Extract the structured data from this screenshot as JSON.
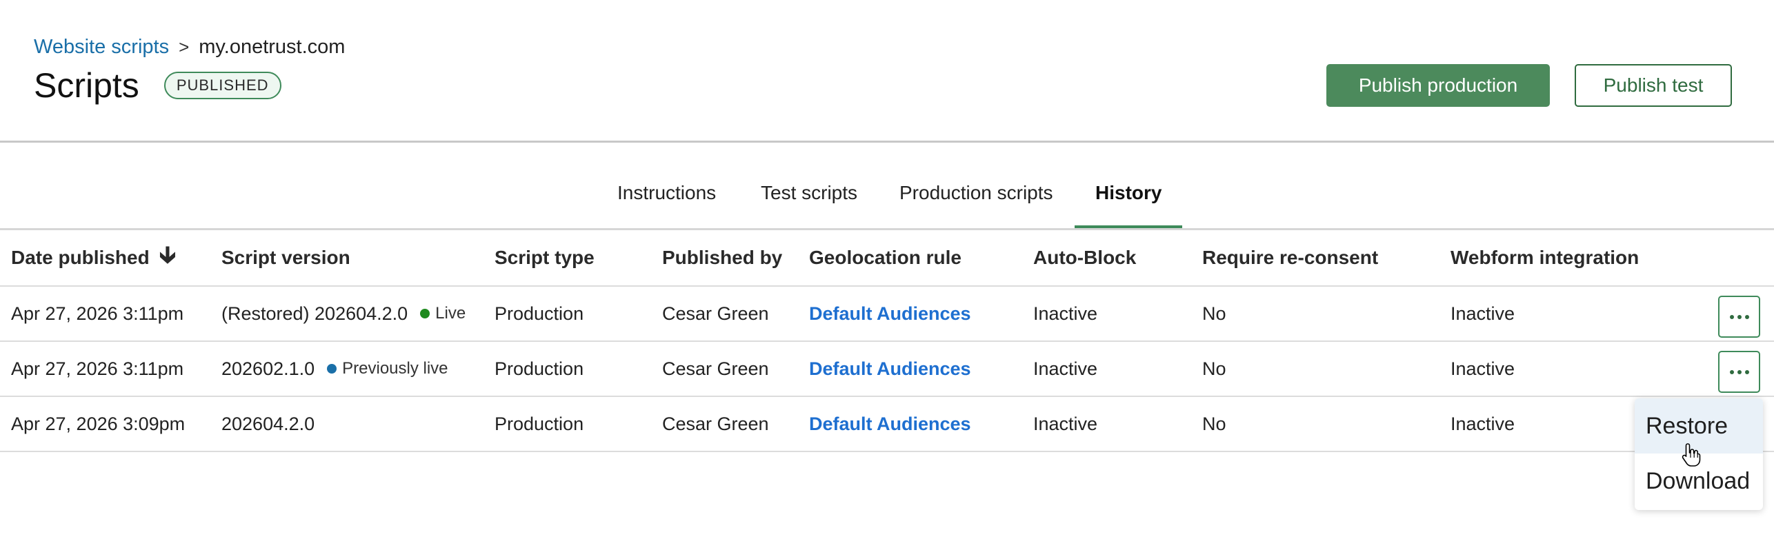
{
  "breadcrumb": {
    "parent": "Website scripts",
    "separator": ">",
    "current": "my.onetrust.com"
  },
  "header": {
    "title": "Scripts",
    "status_badge": "PUBLISHED"
  },
  "actions": {
    "publish_production": "Publish production",
    "publish_test": "Publish test"
  },
  "tabs": [
    {
      "label": "Instructions",
      "active": false
    },
    {
      "label": "Test scripts",
      "active": false
    },
    {
      "label": "Production scripts",
      "active": false
    },
    {
      "label": "History",
      "active": true
    }
  ],
  "table": {
    "columns": [
      "Date published",
      "Script version",
      "Script type",
      "Published by",
      "Geolocation rule",
      "Auto-Block",
      "Require re-consent",
      "Webform integration"
    ],
    "sort_icon": "arrow-down-icon",
    "rows": [
      {
        "date": "Apr 27, 2026 3:11pm",
        "version": "(Restored) 202604.2.0",
        "status": "Live",
        "status_color": "#1f8a1f",
        "type": "Production",
        "by": "Cesar Green",
        "geo": "Default Audiences",
        "autoblock": "Inactive",
        "reconsent": "No",
        "webform": "Inactive"
      },
      {
        "date": "Apr 27, 2026 3:11pm",
        "version": "202602.1.0",
        "status": "Previously live",
        "status_color": "#1a6fa8",
        "type": "Production",
        "by": "Cesar Green",
        "geo": "Default Audiences",
        "autoblock": "Inactive",
        "reconsent": "No",
        "webform": "Inactive"
      },
      {
        "date": "Apr 27, 2026 3:09pm",
        "version": "202604.2.0",
        "status": "",
        "status_color": "",
        "type": "Production",
        "by": "Cesar Green",
        "geo": "Default Audiences",
        "autoblock": "Inactive",
        "reconsent": "No",
        "webform": "Inactive"
      }
    ]
  },
  "row_menu": {
    "items": [
      "Restore",
      "Download"
    ],
    "hovered": "Restore"
  },
  "colors": {
    "primary": "#4c8a5c",
    "link": "#1e6fd0",
    "breadcrumb_link": "#1a6fa8",
    "tab_underline": "#3e8a5a"
  }
}
